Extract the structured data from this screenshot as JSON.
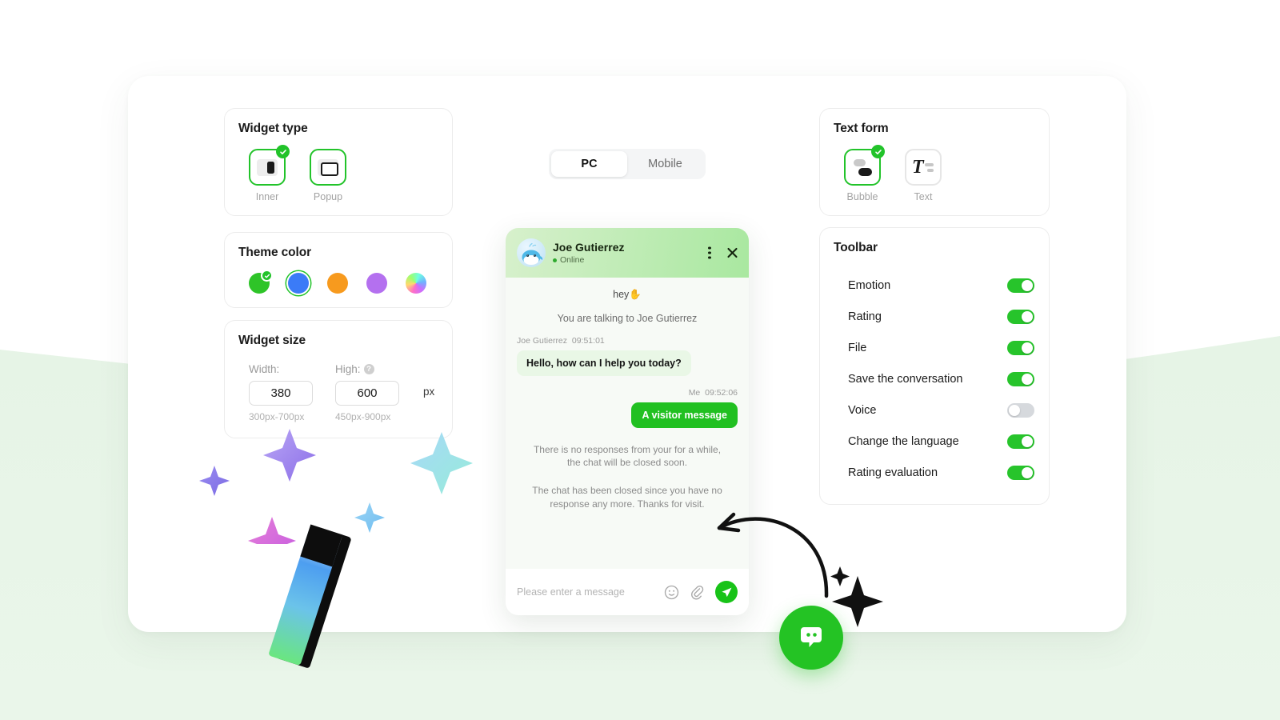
{
  "theme": {
    "accent_green": "#22c32a",
    "toggle_on": "#27c42b",
    "toggle_off": "#d6d9dd",
    "page_bg": "#ffffff",
    "blob_green": "#e7f4e7"
  },
  "panels": {
    "widget_type": {
      "title": "Widget type",
      "options": [
        {
          "label": "Inner",
          "icon": "inner-layout-icon",
          "selected": true
        },
        {
          "label": "Popup",
          "icon": "popup-layout-icon",
          "selected": false
        }
      ]
    },
    "theme_color": {
      "title": "Theme color",
      "swatches": [
        {
          "name": "green",
          "color": "#2ec428",
          "selected": true,
          "ring": false
        },
        {
          "name": "blue",
          "color": "#3b7bf7",
          "selected": false,
          "ring": true
        },
        {
          "name": "orange",
          "color": "#f79a1e",
          "selected": false,
          "ring": false
        },
        {
          "name": "purple",
          "color": "#b470ef",
          "selected": false,
          "ring": false
        },
        {
          "name": "custom",
          "color": "rainbow",
          "selected": false,
          "ring": false
        }
      ]
    },
    "widget_size": {
      "title": "Widget size",
      "width_label": "Width:",
      "width_value": "380",
      "width_hint": "300px-700px",
      "high_label": "High:",
      "high_value": "600",
      "high_hint": "450px-900px",
      "help_icon": "help-circle-icon",
      "help_glyph": "?",
      "unit": "px"
    },
    "text_form": {
      "title": "Text form",
      "options": [
        {
          "label": "Bubble",
          "icon": "bubble-style-icon",
          "selected": true
        },
        {
          "label": "Text",
          "icon": "text-style-icon",
          "selected": false
        }
      ]
    },
    "toolbar": {
      "title": "Toolbar",
      "rows": [
        {
          "label": "Emotion",
          "on": true
        },
        {
          "label": "Rating",
          "on": true
        },
        {
          "label": "File",
          "on": true
        },
        {
          "label": "Save the conversation",
          "on": true
        },
        {
          "label": "Voice",
          "on": false
        },
        {
          "label": "Change the language",
          "on": true
        },
        {
          "label": "Rating evaluation",
          "on": true
        }
      ]
    }
  },
  "device_toggle": {
    "options": [
      {
        "label": "PC",
        "active": true
      },
      {
        "label": "Mobile",
        "active": false
      }
    ]
  },
  "chat_preview": {
    "agent_name": "Joe Gutierrez",
    "status": "Online",
    "avatar_icon": "whale-avatar",
    "kebab_icon": "more-options-icon",
    "close_icon": "close-icon",
    "greeting": "hey✋",
    "system_intro": "You are talking to Joe Gutierrez",
    "incoming": {
      "sender": "Joe Gutierrez",
      "time": "09:51:01",
      "text": "Hello, how can I help you today?"
    },
    "outgoing": {
      "sender": "Me",
      "time": "09:52:06",
      "text": "A visitor message"
    },
    "system_messages": [
      "There is no responses from your for a while, the chat will be closed soon.",
      "The chat has been closed since you have no response any more. Thanks for visit."
    ],
    "input_placeholder": "Please enter a message",
    "emoji_icon": "emoji-smile-icon",
    "attach_icon": "paperclip-icon",
    "send_icon": "send-paper-plane-icon"
  },
  "fab": {
    "icon": "chat-bubble-icon",
    "color": "#24c324"
  },
  "decorations": {
    "marker": "highlighter-marker",
    "arrow": "curved-arrow-pointer",
    "sparkles": "four-point-star-sparkles"
  }
}
